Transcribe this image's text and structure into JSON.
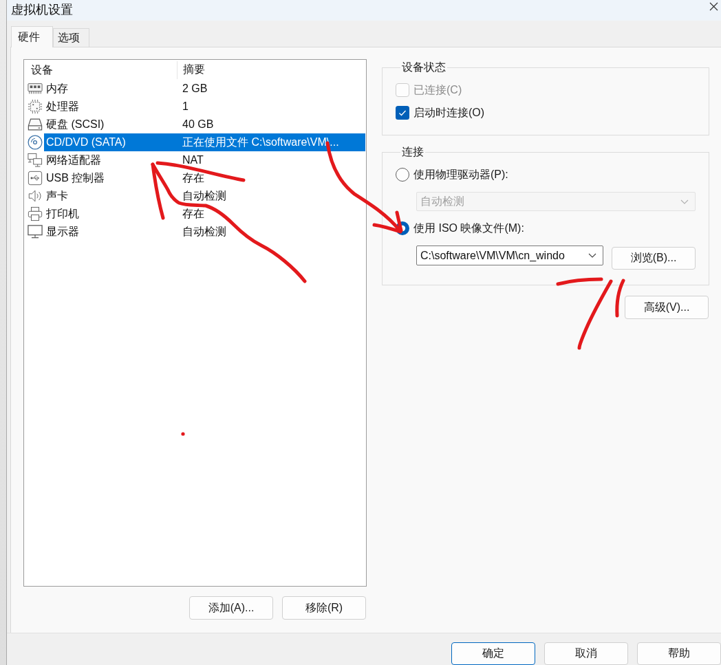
{
  "window": {
    "title": "虚拟机设置"
  },
  "tabs": [
    {
      "label": "硬件",
      "selected": true
    },
    {
      "label": "选项",
      "selected": false
    }
  ],
  "device_list": {
    "columns": [
      "设备",
      "摘要"
    ],
    "rows": [
      {
        "kind": "memory",
        "device": "内存",
        "summary": "2 GB",
        "selected": false
      },
      {
        "kind": "processor",
        "device": "处理器",
        "summary": "1",
        "selected": false
      },
      {
        "kind": "disk",
        "device": "硬盘 (SCSI)",
        "summary": "40 GB",
        "selected": false
      },
      {
        "kind": "cdrom",
        "device": "CD/DVD (SATA)",
        "summary": "正在使用文件 C:\\software\\VM\\...",
        "selected": true
      },
      {
        "kind": "network",
        "device": "网络适配器",
        "summary": "NAT",
        "selected": false
      },
      {
        "kind": "usb",
        "device": "USB 控制器",
        "summary": "存在",
        "selected": false
      },
      {
        "kind": "sound",
        "device": "声卡",
        "summary": "自动检测",
        "selected": false
      },
      {
        "kind": "printer",
        "device": "打印机",
        "summary": "存在",
        "selected": false
      },
      {
        "kind": "display",
        "device": "显示器",
        "summary": "自动检测",
        "selected": false
      }
    ]
  },
  "list_buttons": [
    "添加(A)...",
    "移除(R)"
  ],
  "device_status": {
    "title": "设备状态",
    "checkboxes": [
      {
        "label": "已连接(C)",
        "checked": false,
        "disabled": true
      },
      {
        "label": "启动时连接(O)",
        "checked": true,
        "disabled": false
      }
    ]
  },
  "connection": {
    "title": "连接",
    "options": [
      {
        "label": "使用物理驱动器(P):",
        "selected": false,
        "dropdown": {
          "value": "自动检测",
          "disabled": true
        }
      },
      {
        "label": "使用 ISO 映像文件(M):",
        "selected": true,
        "dropdown": {
          "value": "C:\\software\\VM\\VM\\cn_windo",
          "disabled": false
        },
        "button": "浏览(B)..."
      }
    ]
  },
  "advanced_button": "高级(V)...",
  "footer_buttons": [
    {
      "label": "确定",
      "focused": true
    },
    {
      "label": "取消",
      "focused": false
    },
    {
      "label": "帮助",
      "focused": false
    }
  ]
}
